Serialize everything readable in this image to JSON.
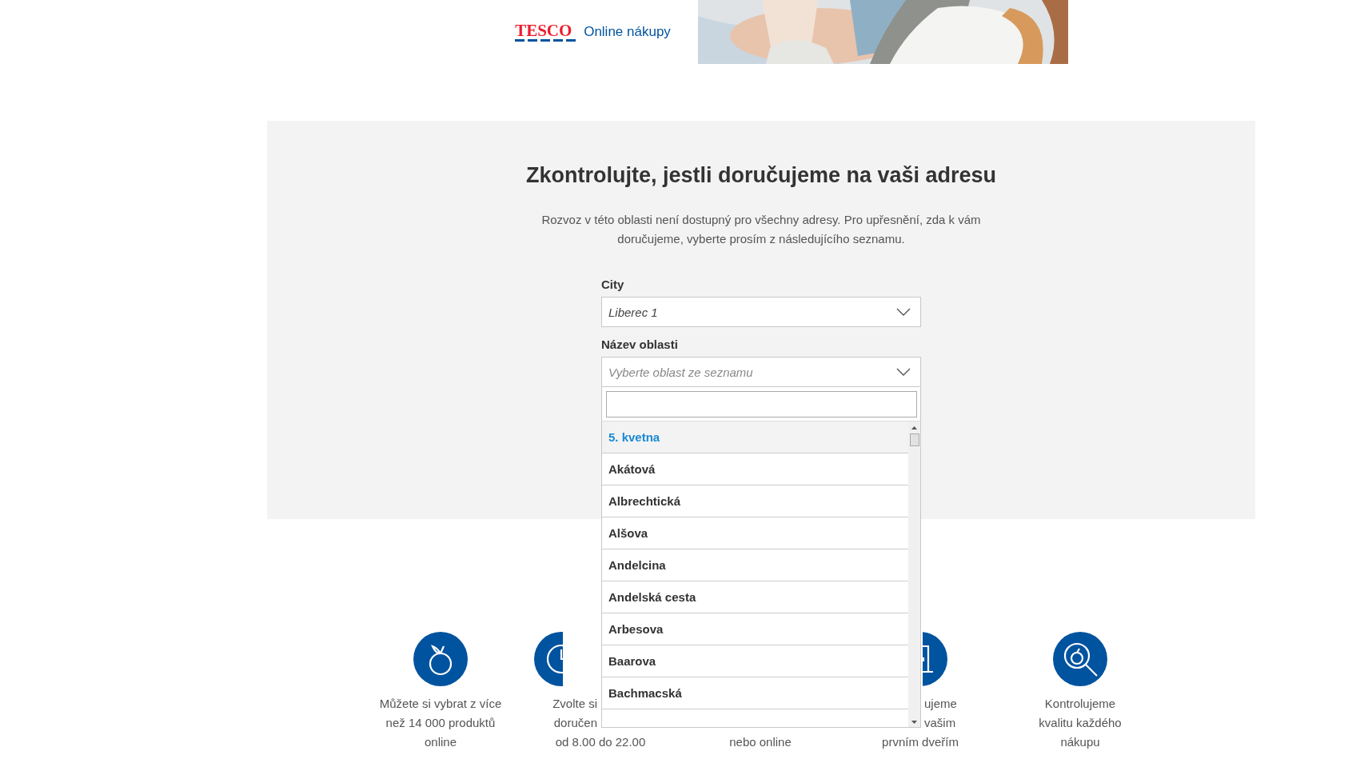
{
  "header": {
    "logo": "TESCO",
    "tagline": "Online nákupy"
  },
  "check": {
    "title": "Zkontrolujte, jestli doručujeme na vaši adresu",
    "description": "Rozvoz v této oblasti není dostupný pro všechny adresy. Pro upřesnění, zda k vám doručujeme, vyberte prosím z následujícího seznamu.",
    "fields": [
      {
        "label": "City",
        "value": "Liberec 1",
        "expanded": false
      },
      {
        "label": "Název oblasti",
        "placeholder": "Vyberte oblast ze seznamu",
        "expanded": true,
        "options": [
          {
            "label": "5. kvetna",
            "selected": true
          },
          {
            "label": "Akátová",
            "selected": false
          },
          {
            "label": "Albrechtická",
            "selected": false
          },
          {
            "label": "Alšova",
            "selected": false
          },
          {
            "label": "Andelcina",
            "selected": false
          },
          {
            "label": "Andelská cesta",
            "selected": false
          },
          {
            "label": "Arbesova",
            "selected": false
          },
          {
            "label": "Baarova",
            "selected": false
          },
          {
            "label": "Bachmacská",
            "selected": false
          }
        ]
      }
    ]
  },
  "features": [
    {
      "lines": [
        "Můžete si vybrat z více",
        "než 14 000 produktů",
        "online"
      ]
    },
    {
      "lines": [
        "Zvolte si",
        "doručen",
        "od 8.00 do 22.00"
      ]
    },
    {
      "lines": [
        "nebo online"
      ]
    },
    {
      "lines": [
        "ujeme",
        "vašim",
        "prvním dveřím"
      ]
    },
    {
      "lines": [
        "Kontrolujeme",
        "kvalitu každého",
        "nákupu"
      ]
    }
  ]
}
